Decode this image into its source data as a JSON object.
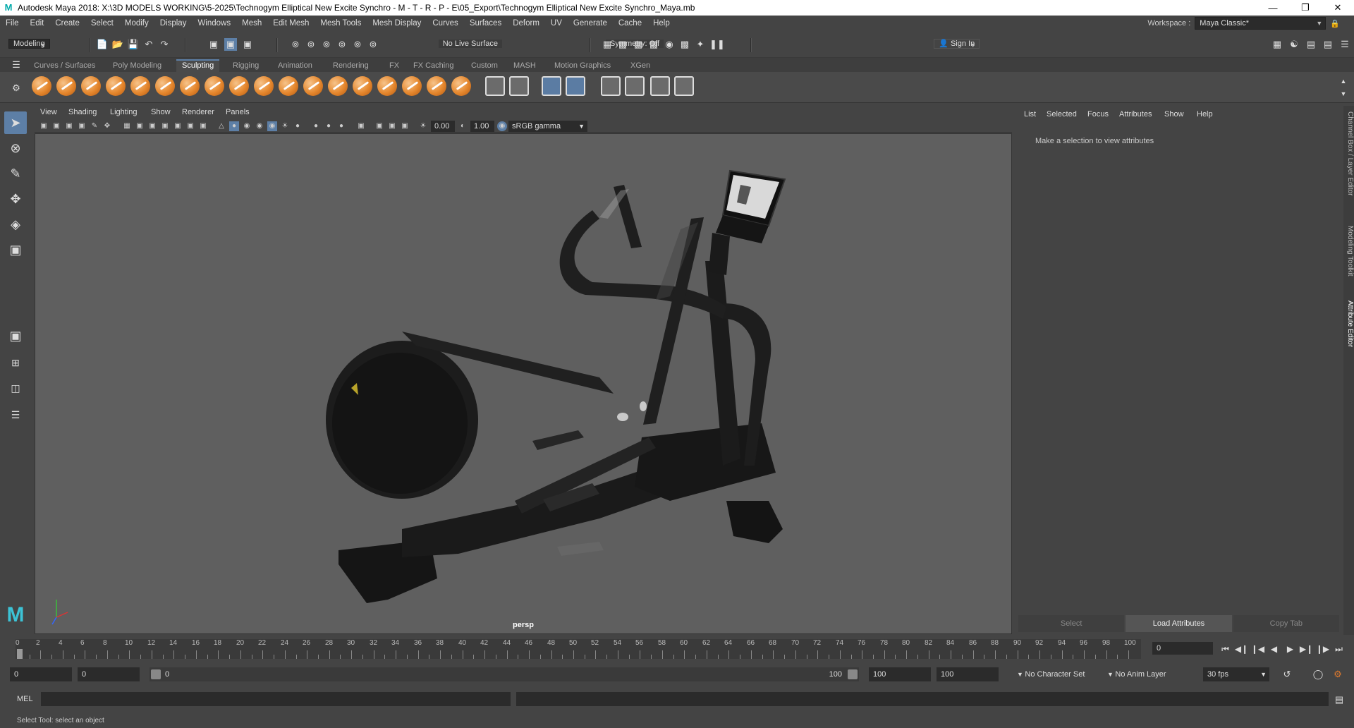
{
  "window": {
    "title": "Autodesk Maya 2018: X:\\3D MODELS WORKING\\5-2025\\Technogym Elliptical New Excite Synchro - M - T - R - P - E\\05_Export\\Technogym Elliptical New Excite Synchro_Maya.mb",
    "logo": "M"
  },
  "menubar": {
    "items": [
      "File",
      "Edit",
      "Create",
      "Select",
      "Modify",
      "Display",
      "Windows",
      "Mesh",
      "Edit Mesh",
      "Mesh Tools",
      "Mesh Display",
      "Curves",
      "Surfaces",
      "Deform",
      "UV",
      "Generate",
      "Cache",
      "Help"
    ],
    "workspace_label": "Workspace :",
    "workspace_value": "Maya Classic*"
  },
  "statusline": {
    "menuset": "Modeling",
    "live_surface": "No Live Surface",
    "symmetry": "Symmetry: Off",
    "sign_in": "Sign In"
  },
  "shelf": {
    "tabs": [
      "Curves / Surfaces",
      "Poly Modeling",
      "Sculpting",
      "Rigging",
      "Animation",
      "Rendering",
      "FX",
      "FX Caching",
      "Custom",
      "MASH",
      "Motion Graphics",
      "XGen"
    ],
    "active_tab": "Sculpting"
  },
  "viewport": {
    "menus": [
      "View",
      "Shading",
      "Lighting",
      "Show",
      "Renderer",
      "Panels"
    ],
    "exposure": "0.00",
    "gamma": "1.00",
    "color_space": "sRGB gamma",
    "camera": "persp"
  },
  "attribute_editor": {
    "menus": [
      "List",
      "Selected",
      "Focus",
      "Attributes",
      "Show",
      "Help"
    ],
    "message": "Make a selection to view attributes",
    "buttons": [
      "Select",
      "Load Attributes",
      "Copy Tab"
    ]
  },
  "side_tabs": [
    "Channel Box / Layer Editor",
    "Modeling Toolkit",
    "Attribute Editor"
  ],
  "timeline": {
    "labels": [
      "2",
      "4",
      "6",
      "8",
      "10",
      "12",
      "14",
      "16",
      "18",
      "20",
      "22",
      "24",
      "26",
      "28",
      "30",
      "32",
      "34",
      "36",
      "38",
      "40",
      "42",
      "44",
      "46",
      "48",
      "50",
      "52",
      "54",
      "56",
      "58",
      "60",
      "62",
      "64",
      "66",
      "68",
      "70",
      "72",
      "74",
      "76",
      "78",
      "80",
      "82",
      "84",
      "86",
      "88",
      "90",
      "92",
      "94",
      "96",
      "98",
      "100"
    ],
    "start_label": "0",
    "current_frame": "0"
  },
  "range": {
    "start": "0",
    "playback_start": "0",
    "slider_start": "0",
    "slider_end": "100",
    "playback_end": "100",
    "end": "100",
    "character_set": "No Character Set",
    "anim_layer": "No Anim Layer",
    "fps": "30 fps"
  },
  "cmdline": {
    "label": "MEL"
  },
  "helpline": {
    "text": "Select Tool: select an object"
  }
}
